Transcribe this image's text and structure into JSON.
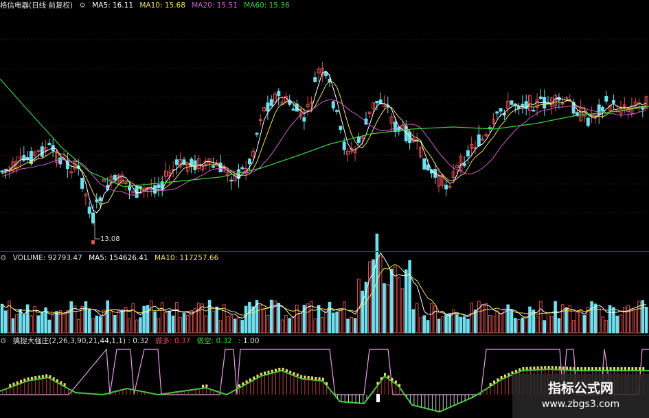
{
  "price_header": {
    "title": "格信电器(日线 前复权)",
    "ma5": "MA5: 16.11",
    "ma10": "MA10: 15.68",
    "ma20": "MA20: 15.51",
    "ma60": "MA60: 15.36"
  },
  "low_label": "13.08",
  "volume_header": {
    "volume": "VOLUME: 92793.47",
    "ma5": "MA5: 154626.41",
    "ma10": "MA10: 117257.66"
  },
  "indicator_header": {
    "name": "擒捉大强庄(2,26,3,90,21,44,1,1)",
    "v1": ": 0.32",
    "duo": "做多: 0.37",
    "kong": "做空: 0.32",
    "v4": ": 1.00"
  },
  "watermark": {
    "title": "指标公式网",
    "url": "www.zbgs3.com"
  },
  "colors": {
    "up": "#e05050",
    "down": "#6fe0f0",
    "ma5": "#ffffff",
    "ma10": "#f0e060",
    "ma20": "#d060d0",
    "ma60": "#40d040",
    "separator": "#8a1c1c"
  }
}
